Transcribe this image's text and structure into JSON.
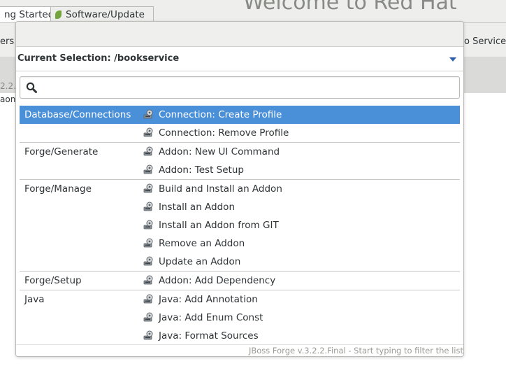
{
  "background": {
    "tabs": [
      {
        "label": "ng Started"
      },
      {
        "label": "Software/Update"
      }
    ],
    "welcome_text": "Welcome to Red Hat",
    "left_toolbar_fragment": "ers",
    "right_toolbar_fragment": "o Service T",
    "version_fragment": "2.2.",
    "left_text_fragment": "aon"
  },
  "popup": {
    "current_selection": "Current Selection: /bookservice",
    "search": {
      "value": "",
      "placeholder": ""
    },
    "footer": "JBoss Forge v.3.2.2.Final - Start typing to filter the list",
    "rows": [
      {
        "category": "Database/Connections",
        "command": "Connection: Create Profile"
      },
      {
        "category": "",
        "command": "Connection: Remove Profile"
      },
      {
        "category": "Forge/Generate",
        "command": "Addon: New UI Command"
      },
      {
        "category": "",
        "command": "Addon: Test Setup"
      },
      {
        "category": "Forge/Manage",
        "command": "Build and Install an Addon"
      },
      {
        "category": "",
        "command": "Install an Addon"
      },
      {
        "category": "",
        "command": "Install an Addon from GIT"
      },
      {
        "category": "",
        "command": "Remove an Addon"
      },
      {
        "category": "",
        "command": "Update an Addon"
      },
      {
        "category": "Forge/Setup",
        "command": "Addon: Add Dependency"
      },
      {
        "category": "Java",
        "command": "Java: Add Annotation"
      },
      {
        "category": "",
        "command": "Java: Add Enum Const"
      },
      {
        "category": "",
        "command": "Java: Format Sources"
      }
    ],
    "selected_index": 0,
    "command_icon": "forge-gear-icon",
    "colors": {
      "selection": "#4a90d9",
      "arrow": "#2f62a8"
    }
  }
}
